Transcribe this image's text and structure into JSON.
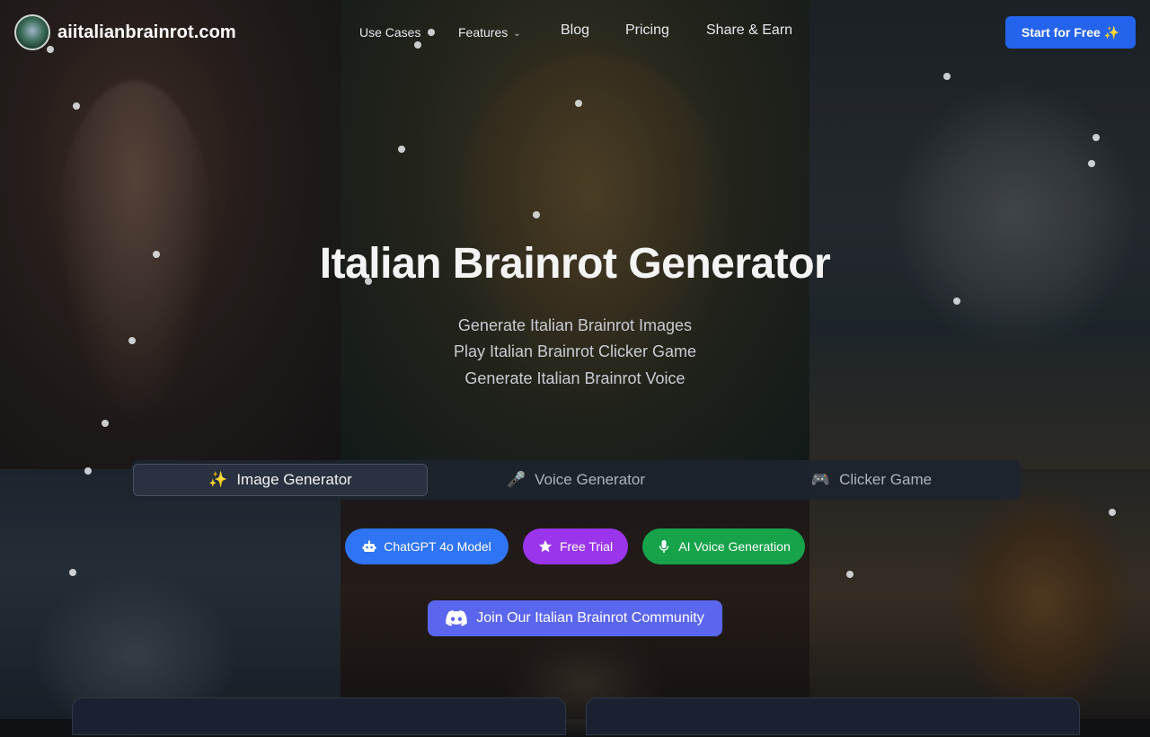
{
  "brand": {
    "name": "aiitalianbrainrot.com"
  },
  "nav": {
    "use_cases": "Use Cases",
    "features": "Features",
    "blog": "Blog",
    "pricing": "Pricing",
    "share_earn": "Share & Earn"
  },
  "cta": {
    "label": "Start for Free ✨"
  },
  "hero": {
    "title": "Italian Brainrot Generator",
    "lines": [
      "Generate Italian Brainrot Images",
      "Play Italian Brainrot Clicker Game",
      "Generate Italian Brainrot Voice"
    ]
  },
  "tabs": [
    {
      "emoji": "✨",
      "label": "Image Generator",
      "active": true
    },
    {
      "emoji": "🎤",
      "label": "Voice Generator",
      "active": false
    },
    {
      "emoji": "🎮",
      "label": "Clicker Game",
      "active": false
    }
  ],
  "badges": {
    "chatgpt": "ChatGPT 4o Model",
    "trial": "Free Trial",
    "voice": "AI Voice Generation"
  },
  "community": {
    "label": "Join Our Italian Brainrot Community"
  },
  "colors": {
    "cta": "#2463eb",
    "badge_blue": "#2f74f2",
    "badge_purple": "#9b35ec",
    "badge_green": "#16a34a",
    "community": "#5b66ee"
  },
  "icons": {
    "chatgpt": "robot-icon",
    "trial": "star-icon",
    "voice": "microphone-icon",
    "community": "discord-icon",
    "features_dropdown": "chevron-down-icon"
  }
}
